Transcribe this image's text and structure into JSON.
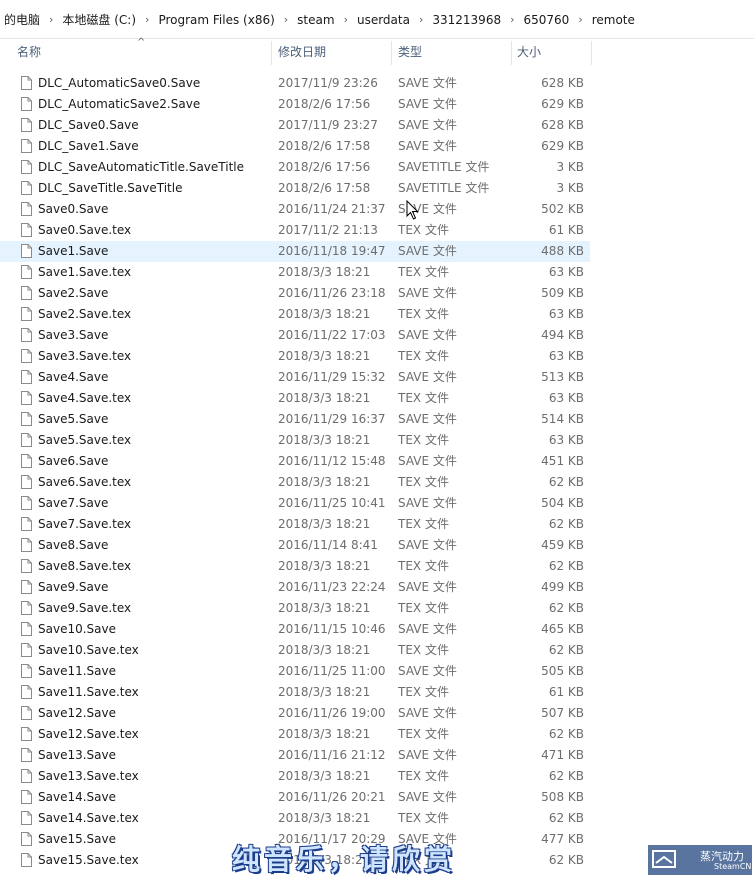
{
  "breadcrumb": [
    "的电脑",
    "本地磁盘 (C:)",
    "Program Files (x86)",
    "steam",
    "userdata",
    "331213968",
    "650760",
    "remote"
  ],
  "columns": {
    "name": "名称",
    "date": "修改日期",
    "type": "类型",
    "size": "大小"
  },
  "selected_index": 9,
  "files": [
    {
      "name": "DLC_AutomaticSave0.Save",
      "date": "2017/11/9 23:26",
      "type": "SAVE 文件",
      "size": "628 KB"
    },
    {
      "name": "DLC_AutomaticSave2.Save",
      "date": "2018/2/6 17:56",
      "type": "SAVE 文件",
      "size": "629 KB"
    },
    {
      "name": "DLC_Save0.Save",
      "date": "2017/11/9 23:27",
      "type": "SAVE 文件",
      "size": "628 KB"
    },
    {
      "name": "DLC_Save1.Save",
      "date": "2018/2/6 17:58",
      "type": "SAVE 文件",
      "size": "629 KB"
    },
    {
      "name": "DLC_SaveAutomaticTitle.SaveTitle",
      "date": "2018/2/6 17:56",
      "type": "SAVETITLE 文件",
      "size": "3 KB"
    },
    {
      "name": "DLC_SaveTitle.SaveTitle",
      "date": "2018/2/6 17:58",
      "type": "SAVETITLE 文件",
      "size": "3 KB"
    },
    {
      "name": "Save0.Save",
      "date": "2016/11/24 21:37",
      "type": "SAVE 文件",
      "size": "502 KB"
    },
    {
      "name": "Save0.Save.tex",
      "date": "2017/11/2 21:13",
      "type": "TEX 文件",
      "size": "61 KB"
    },
    {
      "name": "Save1.Save",
      "date": "2016/11/18 19:47",
      "type": "SAVE 文件",
      "size": "488 KB"
    },
    {
      "name": "Save1.Save.tex",
      "date": "2018/3/3 18:21",
      "type": "TEX 文件",
      "size": "63 KB"
    },
    {
      "name": "Save2.Save",
      "date": "2016/11/26 23:18",
      "type": "SAVE 文件",
      "size": "509 KB"
    },
    {
      "name": "Save2.Save.tex",
      "date": "2018/3/3 18:21",
      "type": "TEX 文件",
      "size": "63 KB"
    },
    {
      "name": "Save3.Save",
      "date": "2016/11/22 17:03",
      "type": "SAVE 文件",
      "size": "494 KB"
    },
    {
      "name": "Save3.Save.tex",
      "date": "2018/3/3 18:21",
      "type": "TEX 文件",
      "size": "63 KB"
    },
    {
      "name": "Save4.Save",
      "date": "2016/11/29 15:32",
      "type": "SAVE 文件",
      "size": "513 KB"
    },
    {
      "name": "Save4.Save.tex",
      "date": "2018/3/3 18:21",
      "type": "TEX 文件",
      "size": "63 KB"
    },
    {
      "name": "Save5.Save",
      "date": "2016/11/29 16:37",
      "type": "SAVE 文件",
      "size": "514 KB"
    },
    {
      "name": "Save5.Save.tex",
      "date": "2018/3/3 18:21",
      "type": "TEX 文件",
      "size": "63 KB"
    },
    {
      "name": "Save6.Save",
      "date": "2016/11/12 15:48",
      "type": "SAVE 文件",
      "size": "451 KB"
    },
    {
      "name": "Save6.Save.tex",
      "date": "2018/3/3 18:21",
      "type": "TEX 文件",
      "size": "62 KB"
    },
    {
      "name": "Save7.Save",
      "date": "2016/11/25 10:41",
      "type": "SAVE 文件",
      "size": "504 KB"
    },
    {
      "name": "Save7.Save.tex",
      "date": "2018/3/3 18:21",
      "type": "TEX 文件",
      "size": "62 KB"
    },
    {
      "name": "Save8.Save",
      "date": "2016/11/14 8:41",
      "type": "SAVE 文件",
      "size": "459 KB"
    },
    {
      "name": "Save8.Save.tex",
      "date": "2018/3/3 18:21",
      "type": "TEX 文件",
      "size": "62 KB"
    },
    {
      "name": "Save9.Save",
      "date": "2016/11/23 22:24",
      "type": "SAVE 文件",
      "size": "499 KB"
    },
    {
      "name": "Save9.Save.tex",
      "date": "2018/3/3 18:21",
      "type": "TEX 文件",
      "size": "62 KB"
    },
    {
      "name": "Save10.Save",
      "date": "2016/11/15 10:46",
      "type": "SAVE 文件",
      "size": "465 KB"
    },
    {
      "name": "Save10.Save.tex",
      "date": "2018/3/3 18:21",
      "type": "TEX 文件",
      "size": "62 KB"
    },
    {
      "name": "Save11.Save",
      "date": "2016/11/25 11:00",
      "type": "SAVE 文件",
      "size": "505 KB"
    },
    {
      "name": "Save11.Save.tex",
      "date": "2018/3/3 18:21",
      "type": "TEX 文件",
      "size": "61 KB"
    },
    {
      "name": "Save12.Save",
      "date": "2016/11/26 19:00",
      "type": "SAVE 文件",
      "size": "507 KB"
    },
    {
      "name": "Save12.Save.tex",
      "date": "2018/3/3 18:21",
      "type": "TEX 文件",
      "size": "62 KB"
    },
    {
      "name": "Save13.Save",
      "date": "2016/11/16 21:12",
      "type": "SAVE 文件",
      "size": "471 KB"
    },
    {
      "name": "Save13.Save.tex",
      "date": "2018/3/3 18:21",
      "type": "TEX 文件",
      "size": "62 KB"
    },
    {
      "name": "Save14.Save",
      "date": "2016/11/26 20:21",
      "type": "SAVE 文件",
      "size": "508 KB"
    },
    {
      "name": "Save14.Save.tex",
      "date": "2018/3/3 18:21",
      "type": "TEX 文件",
      "size": "62 KB"
    },
    {
      "name": "Save15.Save",
      "date": "2016/11/17 20:29",
      "type": "SAVE 文件",
      "size": "477 KB"
    },
    {
      "name": "Save15.Save.tex",
      "date": "2018/3/3 18:21",
      "type": "TEX 文件",
      "size": "62 KB"
    }
  ],
  "overlay": {
    "subtitle": "纯音乐，请欣赏",
    "watermark_line1": "蒸汽动力",
    "watermark_line2": "SteamCN"
  },
  "colors": {
    "selection": "#e5f3ff",
    "header_text": "#4c607a",
    "secondary_text": "#6d6d6d"
  },
  "icons": {
    "file": "file-icon",
    "separator": "chevron-right-icon",
    "sort": "sort-up-icon"
  }
}
